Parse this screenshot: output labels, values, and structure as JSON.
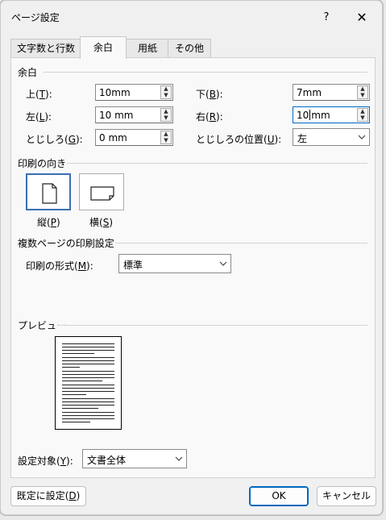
{
  "dialog": {
    "title": "ページ設定",
    "help": "?",
    "close": "✕"
  },
  "tabs": [
    {
      "label": "文字数と行数",
      "active": false
    },
    {
      "label": "余白",
      "active": true
    },
    {
      "label": "用紙",
      "active": false
    },
    {
      "label": "その他",
      "active": false
    }
  ],
  "margins": {
    "section": "余白",
    "top": {
      "label_pre": "上(",
      "key": "T",
      "label_post": "):",
      "value": "10mm"
    },
    "bottom": {
      "label_pre": "下(",
      "key": "B",
      "label_post": "):",
      "value": "7mm"
    },
    "left": {
      "label_pre": "左(",
      "key": "L",
      "label_post": "):",
      "value": "10 mm"
    },
    "right": {
      "label_pre": "右(",
      "key": "R",
      "label_post": "):",
      "value_before_caret": "10",
      "value_after_caret": "mm"
    },
    "gutter": {
      "label_pre": "とじしろ(",
      "key": "G",
      "label_post": "):",
      "value": "0 mm"
    },
    "gutter_pos": {
      "label_pre": "とじしろの位置(",
      "key": "U",
      "label_post": "):",
      "value": "左"
    }
  },
  "orientation": {
    "section": "印刷の向き",
    "portrait": {
      "label_pre": "縦(",
      "key": "P",
      "label_post": ")",
      "selected": true
    },
    "landscape": {
      "label_pre": "横(",
      "key": "S",
      "label_post": ")",
      "selected": false
    }
  },
  "multipage": {
    "section": "複数ページの印刷設定",
    "label_pre": "印刷の形式(",
    "key": "M",
    "label_post": "):",
    "value": "標準"
  },
  "preview": {
    "section": "プレビュー"
  },
  "apply_to": {
    "label_pre": "設定対象(",
    "key": "Y",
    "label_post": "):",
    "value": "文書全体"
  },
  "buttons": {
    "default_pre": "既定に設定(",
    "default_key": "D",
    "default_post": ")",
    "ok": "OK",
    "cancel": "キャンセル"
  },
  "icons": {
    "spin": "spin-arrows-icon",
    "dropdown": "chevron-down-icon",
    "portrait": "portrait-page-icon",
    "landscape": "landscape-page-icon"
  },
  "colors": {
    "accent": "#0067c0",
    "selected_border": "#3b6fb4"
  }
}
